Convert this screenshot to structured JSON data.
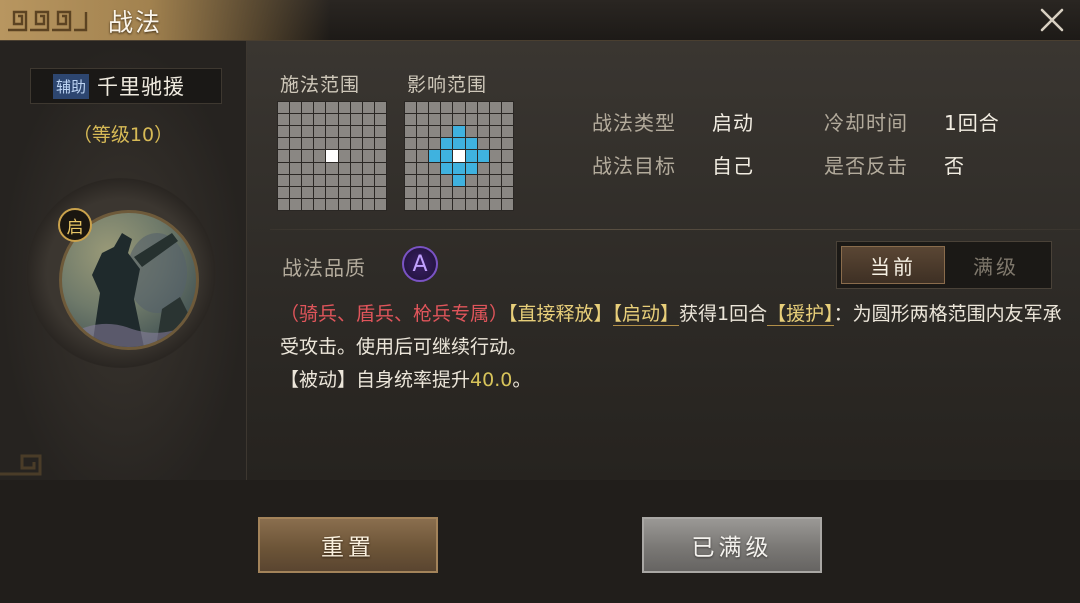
{
  "window": {
    "title": "战法",
    "close_icon": "close-icon"
  },
  "skill": {
    "role_tag": "辅助",
    "name": "千里驰援",
    "level": "（等级10）",
    "activation_badge": "启"
  },
  "ranges": {
    "cast_label": "施法范围",
    "effect_label": "影响范围"
  },
  "info": {
    "type_label": "战法类型",
    "type_value": "启动",
    "cooldown_label": "冷却时间",
    "cooldown_value": "1回合",
    "target_label": "战法目标",
    "target_value": "自己",
    "counter_label": "是否反击",
    "counter_value": "否"
  },
  "quality": {
    "label": "战法品质",
    "grade": "A"
  },
  "toggle": {
    "current": "当前",
    "max": "满级",
    "selected": "current"
  },
  "description": {
    "exclusive": "（骑兵、盾兵、枪兵专属）",
    "tag_direct": "【直接释放】",
    "tag_start": "【启动】",
    "text_gain": "获得1回合",
    "tag_support": "【援护】",
    "text_effect": "：为圆形两格范围内友军承受攻击。使用后可继续行动。",
    "tag_passive": "【被动】",
    "text_passive": "自身统率提升",
    "passive_value": "40.0",
    "text_end": "。"
  },
  "buttons": {
    "reset": "重置",
    "max_level": "已满级"
  },
  "colors": {
    "gold_text": "#d7ba56",
    "red_text": "#e0555b",
    "area_cell": "#3fb2df",
    "quality_purple": "#7a53c4"
  }
}
